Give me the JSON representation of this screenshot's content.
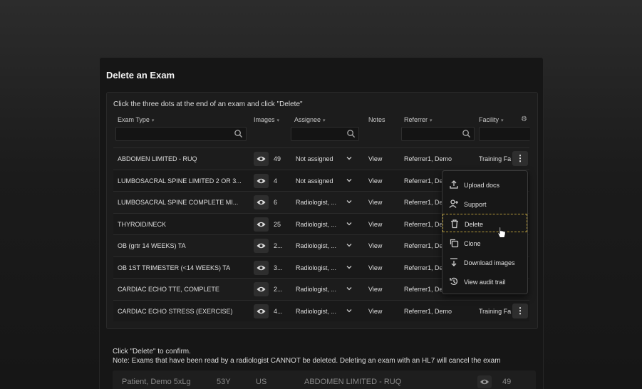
{
  "title": "Delete an Exam",
  "instruction": "Click the three dots at the end of an exam and click \"Delete\"",
  "columns": {
    "exam_type": "Exam Type",
    "images": "Images",
    "assignee": "Assignee",
    "notes": "Notes",
    "referrer": "Referrer",
    "facility": "Facility"
  },
  "rows": [
    {
      "exam": "ABDOMEN LIMITED - RUQ",
      "images": "49",
      "assignee": "Not assigned",
      "notes": "View",
      "referrer": "Referrer1, Demo",
      "facility": "Training Fa"
    },
    {
      "exam": "LUMBOSACRAL SPINE LIMITED 2 OR 3...",
      "images": "4",
      "assignee": "Not assigned",
      "notes": "View",
      "referrer": "Referrer1, De",
      "facility": ""
    },
    {
      "exam": "LUMBOSACRAL SPINE COMPLETE MI...",
      "images": "6",
      "assignee": "Radiologist, ...",
      "notes": "View",
      "referrer": "Referrer1, De",
      "facility": ""
    },
    {
      "exam": "THYROID/NECK",
      "images": "25",
      "assignee": "Radiologist, ...",
      "notes": "View",
      "referrer": "Referrer1, De",
      "facility": ""
    },
    {
      "exam": "OB (grtr 14 WEEKS) TA",
      "images": "2...",
      "assignee": "Radiologist, ...",
      "notes": "View",
      "referrer": "Referrer1, De",
      "facility": ""
    },
    {
      "exam": "OB 1ST TRIMESTER (<14 WEEKS) TA",
      "images": "3...",
      "assignee": "Radiologist, ...",
      "notes": "View",
      "referrer": "Referrer1, De",
      "facility": ""
    },
    {
      "exam": "CARDIAC ECHO TTE, COMPLETE",
      "images": "2...",
      "assignee": "Radiologist, ...",
      "notes": "View",
      "referrer": "Referrer1, De",
      "facility": ""
    },
    {
      "exam": "CARDIAC ECHO STRESS (EXERCISE)",
      "images": "4...",
      "assignee": "Radiologist, ...",
      "notes": "View",
      "referrer": "Referrer1, Demo",
      "facility": "Training Fa"
    }
  ],
  "menu": {
    "upload": "Upload docs",
    "support": "Support",
    "delete": "Delete",
    "clone": "Clone",
    "download": "Download images",
    "audit": "View audit trail"
  },
  "confirm": {
    "line1": "Click \"Delete\" to confirm.",
    "line2": "Note: Exams that have been read by a radiologist CANNOT be deleted. Deleting an exam with an HL7 will cancel the exam"
  },
  "patient_row": {
    "name": "Patient, Demo 5xLg",
    "age": "53Y",
    "modality": "US",
    "exam": "ABDOMEN LIMITED - RUQ",
    "images": "49"
  }
}
